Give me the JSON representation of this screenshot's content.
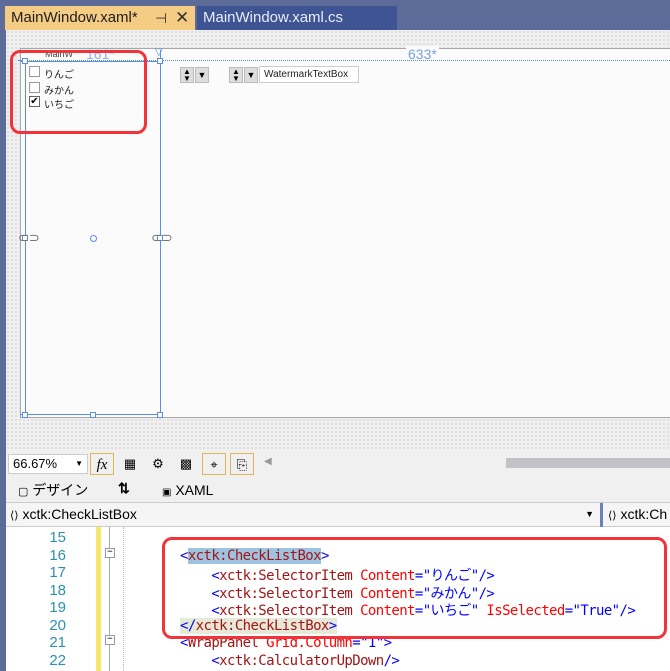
{
  "tabs": [
    {
      "label": "MainWindow.xaml*",
      "active": true
    },
    {
      "label": "MainWindow.xaml.cs",
      "active": false
    }
  ],
  "tab_icons": {
    "pin": "pin-icon",
    "close": "close-icon"
  },
  "designer": {
    "window_label": "MainW",
    "column_width_1": "161*",
    "column_width_2": "633*",
    "checklist": [
      {
        "label": "りんご",
        "checked": false
      },
      {
        "label": "みかん",
        "checked": false
      },
      {
        "label": "いちご",
        "checked": true
      }
    ],
    "watermark_textbox": "WatermarkTextBox"
  },
  "toolbar": {
    "zoom": "66.67%",
    "fx": "fx"
  },
  "view_tabs": {
    "design": "デザイン",
    "swap": "⇅",
    "xaml": "XAML"
  },
  "navbar": {
    "left": "xctk:CheckListBox",
    "right": "xctk:Ch"
  },
  "code": {
    "lines": [
      {
        "n": "15",
        "seg": []
      },
      {
        "n": "16",
        "seg": [
          [
            "p",
            "<"
          ],
          [
            "t",
            "xctk:CheckListBox"
          ],
          [
            "p",
            ">"
          ]
        ]
      },
      {
        "n": "17",
        "seg": [
          [
            "p",
            "    <"
          ],
          [
            "t",
            "xctk:SelectorItem"
          ],
          [
            "a",
            " Content"
          ],
          [
            "p",
            "=\"りんご\"/>"
          ]
        ]
      },
      {
        "n": "18",
        "seg": [
          [
            "p",
            "    <"
          ],
          [
            "t",
            "xctk:SelectorItem"
          ],
          [
            "a",
            " Content"
          ],
          [
            "p",
            "=\"みかん\"/>"
          ]
        ]
      },
      {
        "n": "19",
        "seg": [
          [
            "p",
            "    <"
          ],
          [
            "t",
            "xctk:SelectorItem"
          ],
          [
            "a",
            " Content"
          ],
          [
            "p",
            "=\"いちご\""
          ],
          [
            "a",
            " IsSelected"
          ],
          [
            "p",
            "=\"True\"/>"
          ]
        ]
      },
      {
        "n": "20",
        "seg": [
          [
            "p",
            "</"
          ],
          [
            "t",
            "xctk:CheckListBox"
          ],
          [
            "p",
            ">"
          ]
        ]
      },
      {
        "n": "21",
        "seg": [
          [
            "p",
            "<"
          ],
          [
            "t",
            "WrapPanel"
          ],
          [
            "a",
            " Grid.Column"
          ],
          [
            "p",
            "=\"1\">"
          ]
        ]
      },
      {
        "n": "22",
        "seg": [
          [
            "p",
            "    <"
          ],
          [
            "t",
            "xctk:CalculatorUpDown"
          ],
          [
            "p",
            "/>"
          ]
        ]
      }
    ]
  },
  "colors": {
    "accent": "#5b8def",
    "highlight": "#f2333a",
    "active_tab": "#f5cc84"
  }
}
